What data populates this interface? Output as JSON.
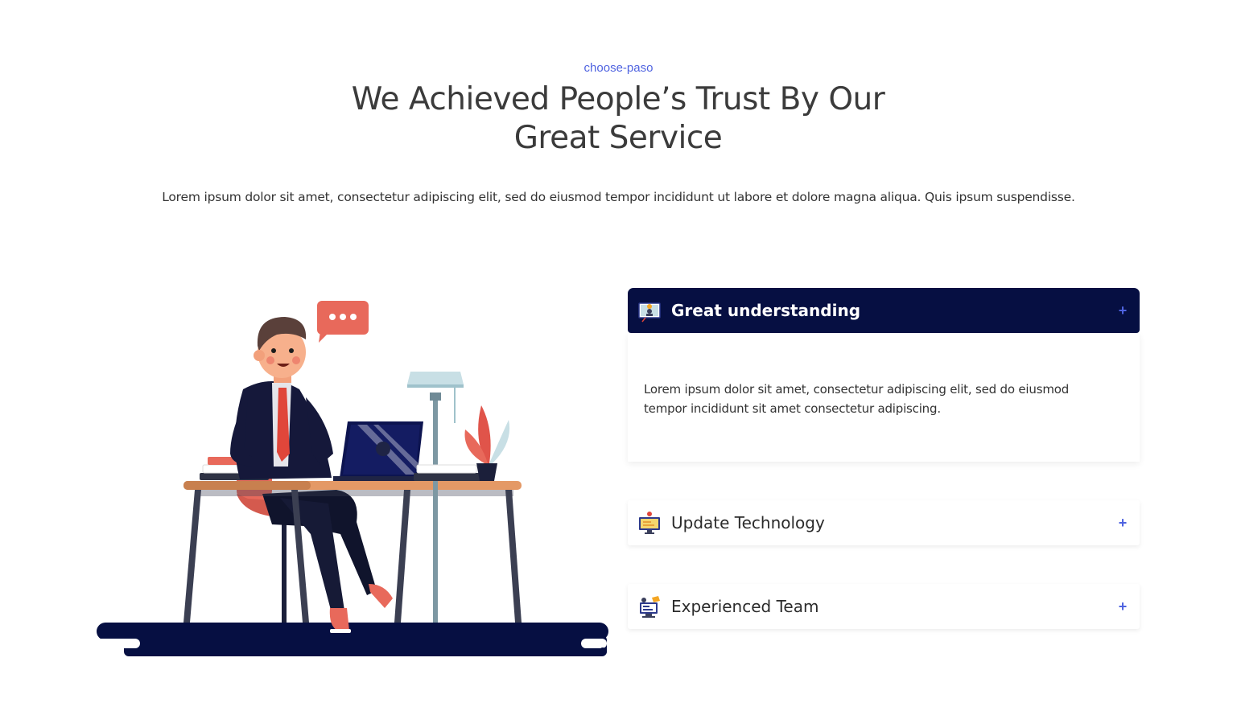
{
  "section": {
    "eyebrow": "choose-paso",
    "title_line1": "We Achieved People’s Trust By Our",
    "title_line2": "Great Service",
    "lead": "Lorem ipsum dolor sit amet, consectetur adipiscing elit, sed do eiusmod tempor incididunt ut labore et dolore magna aliqua. Quis ipsum suspendisse."
  },
  "accordion": {
    "items": [
      {
        "title": "Great understanding",
        "icon": "presentation-icon",
        "toggle": "+",
        "expanded": true,
        "body": "Lorem ipsum dolor sit amet, consectetur adipiscing elit, sed do eiusmod tempor incididunt sit amet consectetur adipiscing."
      },
      {
        "title": "Update Technology",
        "icon": "monitor-icon",
        "toggle": "+",
        "expanded": false
      },
      {
        "title": "Experienced Team",
        "icon": "team-computer-icon",
        "toggle": "+",
        "expanded": false
      }
    ]
  },
  "colors": {
    "accent": "#4f63e0",
    "navy": "#060f42",
    "coral": "#e8695b"
  }
}
